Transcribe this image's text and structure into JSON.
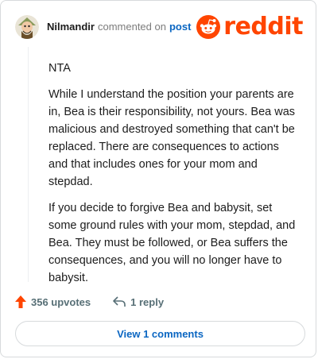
{
  "header": {
    "username": "Nilmandir",
    "action_text": "commented on",
    "target_text": "post",
    "brand_text": "reddit",
    "brand_color": "#ff4500",
    "avatar_icon": "user-avatar-icon"
  },
  "comment": {
    "paragraphs": [
      "NTA",
      "While I understand the position your parents are in, Bea is their responsibility, not yours. Bea was malicious and destroyed something that can't be replaced. There are consequences to actions and that includes ones for your mom and stepdad.",
      "If you decide to forgive Bea and babysit, set some ground rules with your mom, stepdad, and Bea. They must be followed, or Bea suffers the consequences, and you will no longer have to babysit."
    ]
  },
  "actions": {
    "upvotes_label": "356 upvotes",
    "reply_label": "1 reply",
    "upvote_icon": "upvote-arrow-icon",
    "reply_icon": "reply-arrow-icon",
    "upvote_color": "#ff4500"
  },
  "footer": {
    "view_comments_label": "View 1 comments"
  }
}
